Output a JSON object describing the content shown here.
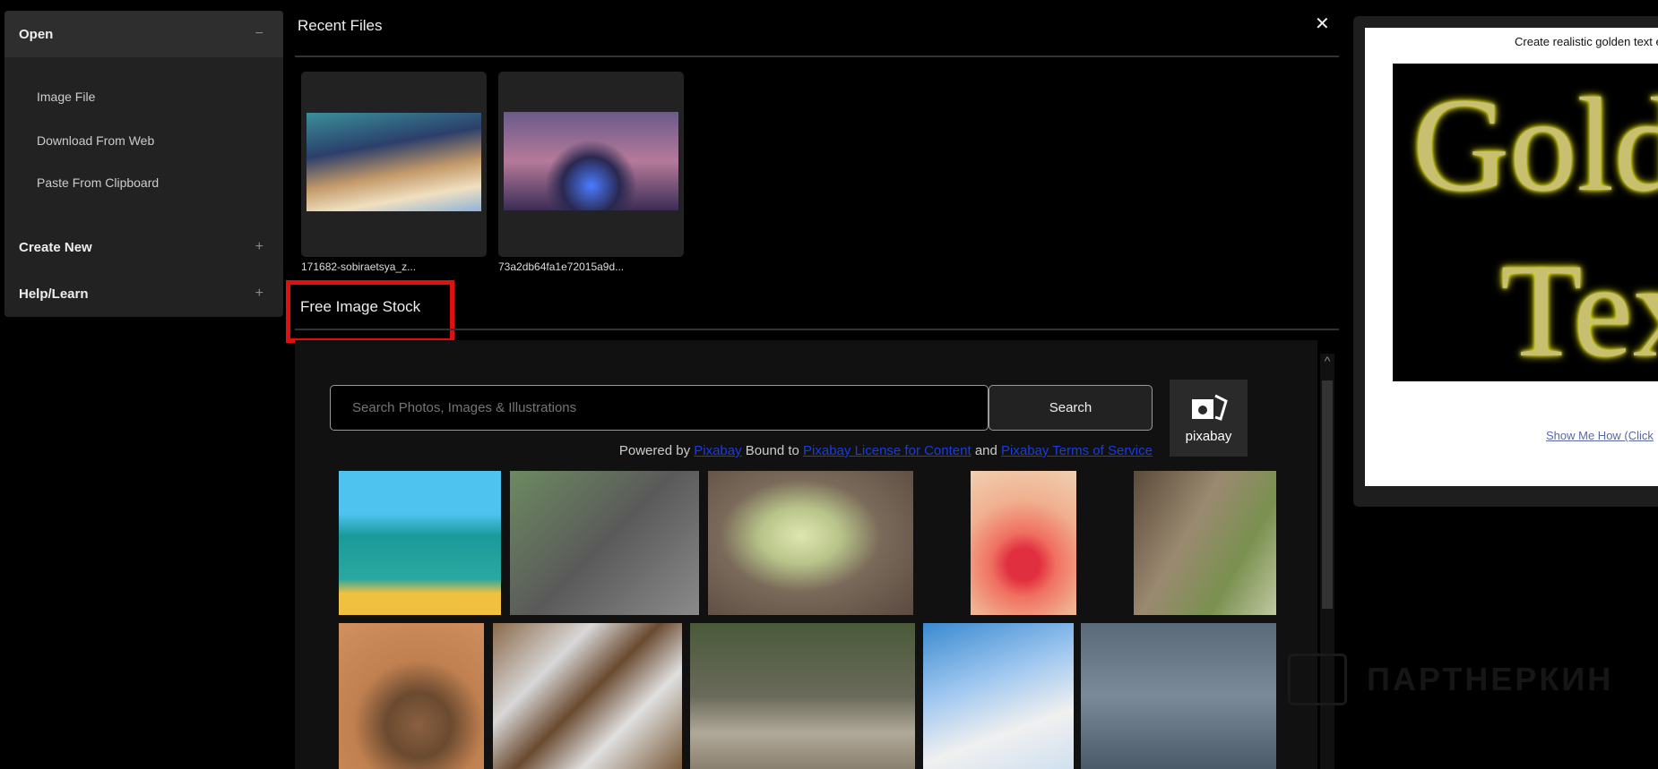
{
  "sidebar": {
    "open": {
      "label": "Open",
      "sign": "−",
      "items": [
        "Image File",
        "Download From Web",
        "Paste From Clipboard"
      ]
    },
    "create_new": {
      "label": "Create New",
      "sign": "+"
    },
    "help_learn": {
      "label": "Help/Learn",
      "sign": "+"
    }
  },
  "recent": {
    "title": "Recent Files",
    "close": "✕",
    "files": [
      {
        "name": "171682-sobiraetsya_z..."
      },
      {
        "name": "73a2db64fa1e72015a9d..."
      }
    ]
  },
  "stock": {
    "title": "Free Image Stock",
    "search_placeholder": "Search Photos, Images & Illustrations",
    "search_button": "Search",
    "logo_text": "pixabay",
    "powered_by": "Powered by",
    "pixabay_link": "Pixabay",
    "bound_to": "Bound to",
    "license_link": "Pixabay License for Content",
    "and": "and",
    "terms_link": "Pixabay Terms of Service",
    "scroll_up": "^"
  },
  "promo": {
    "caption": "Create realistic golden text effe",
    "image_text_1": "Gold",
    "image_text_2": "Tex",
    "link": "Show Me How (Click"
  },
  "watermark": "ПАРТНЕРКИН"
}
